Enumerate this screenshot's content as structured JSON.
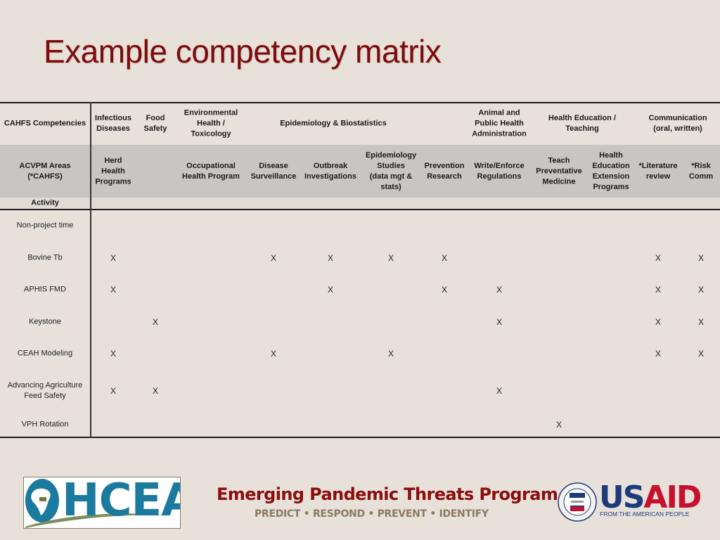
{
  "slide": {
    "title": "Example competency matrix"
  },
  "matrix": {
    "row1_header_label": "CAHFS Competencies",
    "row2_header_label": "ACVPM Areas\n(*CAHFS)",
    "row3_header_label": "Activity",
    "competencies": [
      {
        "label": "Infectious\nDiseases"
      },
      {
        "label": "Food\nSafety"
      },
      {
        "label": "Environmental\nHealth /\nToxicology"
      },
      {
        "label": "Epidemiology & Biostatistics"
      },
      {
        "label": "Animal and\nPublic Health\nAdministration"
      },
      {
        "label": "Health Education /\nTeaching"
      },
      {
        "label": "Communication\n(oral, written)"
      }
    ],
    "areas": [
      {
        "label": "Herd\nHealth\nPrograms"
      },
      {
        "label": ""
      },
      {
        "label": "Occupational\nHealth Program"
      },
      {
        "label": "Disease\nSurveillance"
      },
      {
        "label": "Outbreak\nInvestigations"
      },
      {
        "label": "Epidemiology\nStudies\n(data mgt &\nstats)"
      },
      {
        "label": "Prevention\nResearch"
      },
      {
        "label": "Write/Enforce\nRegulations"
      },
      {
        "label": "Teach\nPreventative\nMedicine"
      },
      {
        "label": "Health\nEducation\nExtension\nPrograms"
      },
      {
        "label": "*Literature\nreview"
      },
      {
        "label": "*Risk\nComm"
      }
    ],
    "mark_symbol": "X",
    "activities": [
      {
        "label": "Non-project time",
        "marks": [
          0,
          0,
          0,
          0,
          0,
          0,
          0,
          0,
          0,
          0,
          0,
          0
        ]
      },
      {
        "label": "Bovine Tb",
        "marks": [
          1,
          0,
          0,
          1,
          1,
          1,
          1,
          0,
          0,
          0,
          1,
          1
        ]
      },
      {
        "label": "APHIS FMD",
        "marks": [
          1,
          0,
          0,
          0,
          1,
          0,
          1,
          1,
          0,
          0,
          1,
          1
        ]
      },
      {
        "label": "Keystone",
        "marks": [
          0,
          1,
          0,
          0,
          0,
          0,
          0,
          1,
          0,
          0,
          1,
          1
        ]
      },
      {
        "label": "CEAH Modeling",
        "marks": [
          1,
          0,
          0,
          1,
          0,
          1,
          0,
          0,
          0,
          0,
          1,
          1
        ]
      },
      {
        "label": "Advancing Agriculture\nFeed Safety",
        "marks": [
          1,
          1,
          0,
          0,
          0,
          0,
          0,
          1,
          0,
          0,
          0,
          0
        ]
      },
      {
        "label": "VPH Rotation",
        "marks": [
          0,
          0,
          0,
          0,
          0,
          0,
          0,
          0,
          1,
          0,
          0,
          0
        ]
      }
    ]
  },
  "footer": {
    "program_title": "Emerging Pandemic Threats Program",
    "program_subtitle": "PREDICT • RESPOND • PREVENT • IDENTIFY",
    "left_logo": {
      "text": "HCEA",
      "icon": "africa-globe-icon"
    },
    "right_logo": {
      "text_primary_a": "US",
      "text_primary_b": "AID",
      "tagline": "FROM THE AMERICAN PEOPLE",
      "seal_text": "USAID",
      "icon": "usaid-seal-icon"
    },
    "colors": {
      "title_red": "#7f0a0a",
      "subtitle_tan": "#8c7a63",
      "hcea_blue": "#1b7a9e",
      "usaid_blue": "#1d3a7a",
      "usaid_red": "#c8102e"
    }
  }
}
